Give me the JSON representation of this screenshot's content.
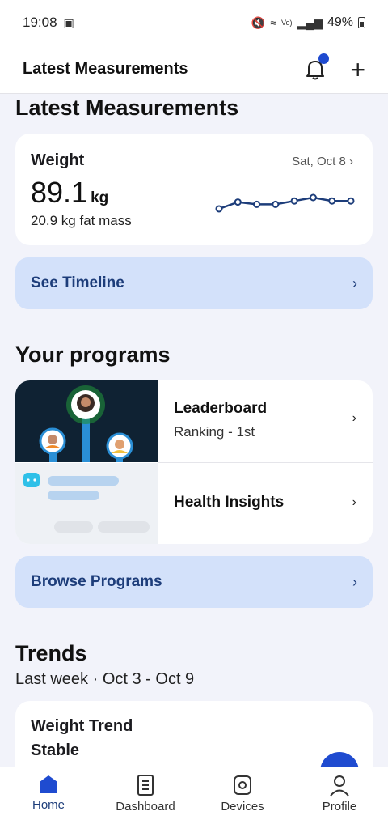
{
  "status_bar": {
    "time": "19:08",
    "battery": "49%"
  },
  "app_bar": {
    "title": "Latest Measurements"
  },
  "measurements": {
    "heading": "Latest Measurements",
    "weight": {
      "label": "Weight",
      "date": "Sat, Oct 8",
      "value": "89.1",
      "unit": "kg",
      "fat_mass": "20.9 kg fat mass",
      "sparkline_trend": [
        0.25,
        0.55,
        0.45,
        0.45,
        0.6,
        0.75,
        0.6,
        0.6
      ]
    },
    "see_timeline": "See Timeline"
  },
  "programs": {
    "heading": "Your programs",
    "items": [
      {
        "name": "Leaderboard",
        "subtitle": "Ranking - 1st"
      },
      {
        "name": "Health Insights",
        "subtitle": ""
      }
    ],
    "browse": "Browse Programs"
  },
  "trends": {
    "heading": "Trends",
    "range": "Last week · Oct 3 - Oct 9",
    "card_title": "Weight Trend",
    "card_status": "Stable"
  },
  "bottom_nav": [
    {
      "label": "Home",
      "icon": "home-icon",
      "active": true
    },
    {
      "label": "Dashboard",
      "icon": "dashboard-icon",
      "active": false
    },
    {
      "label": "Devices",
      "icon": "watch-icon",
      "active": false
    },
    {
      "label": "Profile",
      "icon": "profile-icon",
      "active": false
    }
  ],
  "colors": {
    "accent": "#1f4bd0",
    "pill_bg": "#d3e1fa",
    "pill_text": "#1d3d7a",
    "background": "#f2f3fa"
  }
}
